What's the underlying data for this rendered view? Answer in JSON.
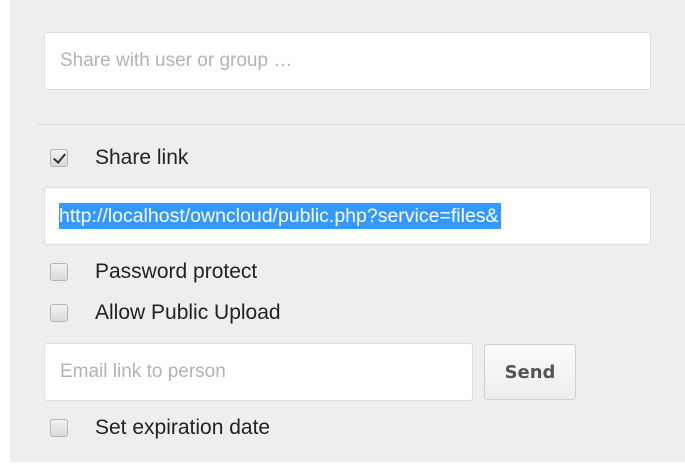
{
  "share": {
    "placeholder": "Share with user or group …"
  },
  "share_link": {
    "checked": true,
    "label": "Share link",
    "url": "http://localhost/owncloud/public.php?service=files&"
  },
  "options": {
    "password_protect_label": "Password protect",
    "allow_upload_label": "Allow Public Upload",
    "email_placeholder": "Email link to person",
    "send_label": "Send",
    "expiration_label": "Set expiration date"
  },
  "colors": {
    "panel_bg": "#eeeeee",
    "selection": "#3399ff"
  }
}
